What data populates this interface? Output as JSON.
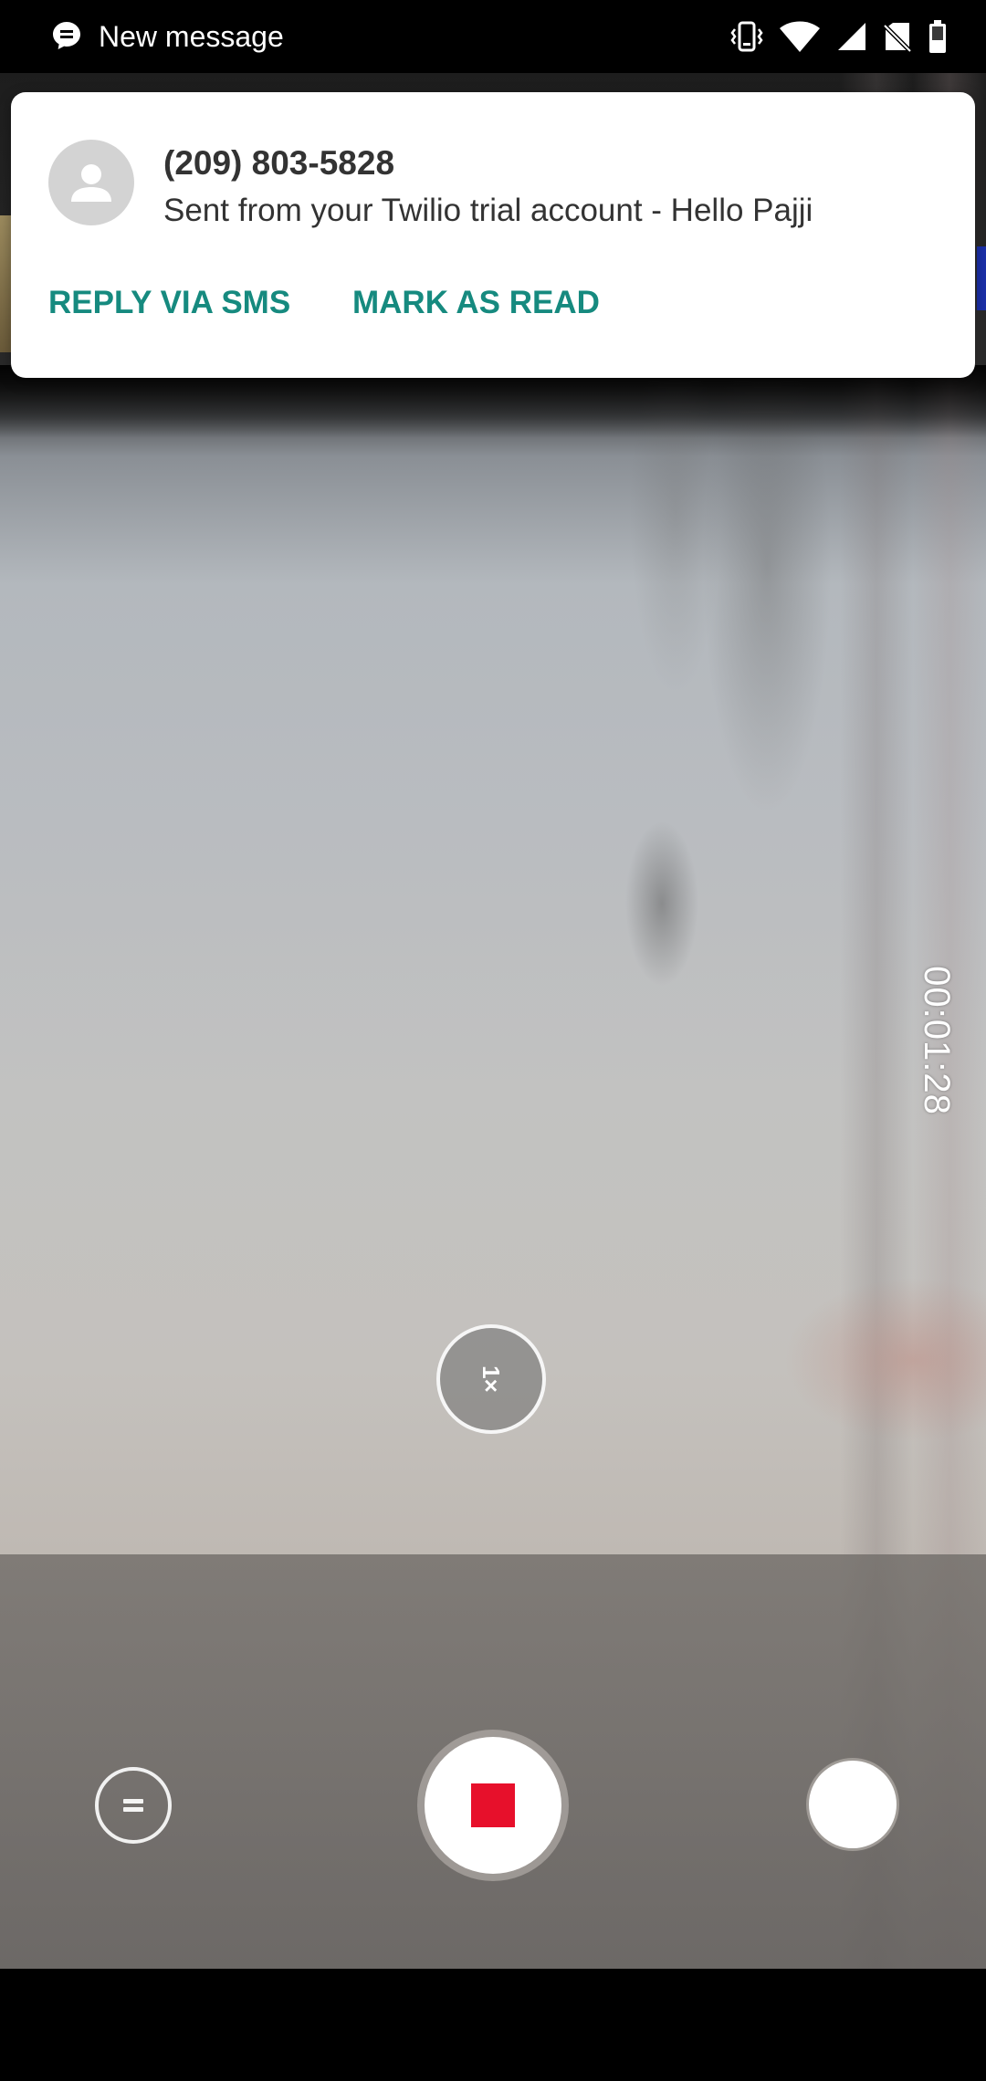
{
  "status_bar": {
    "title": "New message",
    "icons": [
      "message-icon",
      "vibrate-icon",
      "wifi-icon",
      "signal-icon",
      "no-sim-icon",
      "battery-icon"
    ]
  },
  "notification": {
    "sender": "(209) 803-5828",
    "body": "Sent from your Twilio trial account - Hello Pajji",
    "actions": {
      "reply": "REPLY VIA SMS",
      "mark_read": "MARK AS READ"
    },
    "accent_color": "#168a7f"
  },
  "camera": {
    "timer": "00:01:28",
    "zoom": "1×",
    "record_color": "#e7102b",
    "controls": [
      "pause-icon",
      "stop-icon",
      "snapshot-icon"
    ]
  }
}
